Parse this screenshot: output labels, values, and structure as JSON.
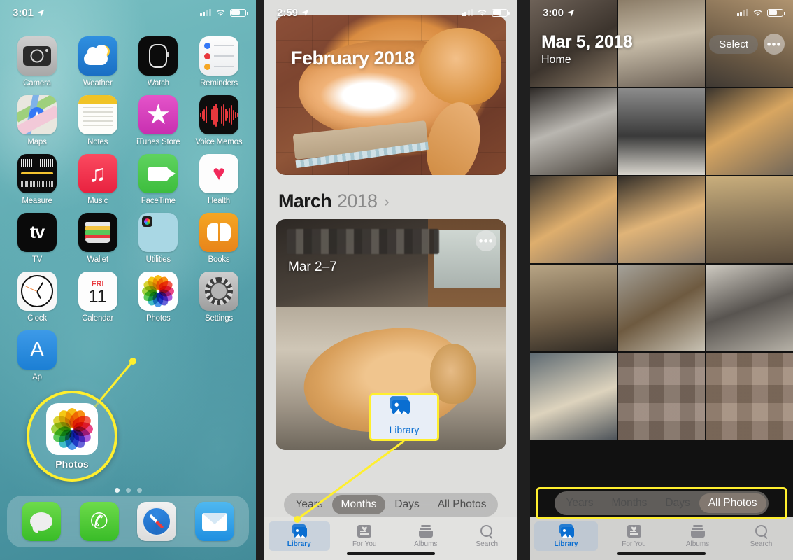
{
  "panel1": {
    "status": {
      "time": "3:01",
      "location_icon": "location-arrow-icon",
      "signal_icon": "cellular-signal-icon",
      "wifi_icon": "wifi-icon",
      "battery_icon": "battery-icon"
    },
    "apps_rows": [
      [
        {
          "label": "Camera",
          "icon": "camera-icon"
        },
        {
          "label": "Weather",
          "icon": "weather-icon"
        },
        {
          "label": "Watch",
          "icon": "watch-icon"
        },
        {
          "label": "Reminders",
          "icon": "reminders-icon"
        }
      ],
      [
        {
          "label": "Maps",
          "icon": "maps-icon"
        },
        {
          "label": "Notes",
          "icon": "notes-icon"
        },
        {
          "label": "iTunes Store",
          "icon": "itunes-store-icon"
        },
        {
          "label": "Voice Memos",
          "icon": "voice-memos-icon"
        }
      ],
      [
        {
          "label": "Measure",
          "icon": "measure-icon"
        },
        {
          "label": "Music",
          "icon": "music-icon"
        },
        {
          "label": "FaceTime",
          "icon": "facetime-icon"
        },
        {
          "label": "Health",
          "icon": "health-icon"
        }
      ],
      [
        {
          "label": "TV",
          "icon": "tv-icon"
        },
        {
          "label": "Wallet",
          "icon": "wallet-icon"
        },
        {
          "label": "Utilities",
          "icon": "utilities-folder-icon"
        },
        {
          "label": "Books",
          "icon": "books-icon"
        }
      ],
      [
        {
          "label": "Clock",
          "icon": "clock-icon"
        },
        {
          "label": "Calendar",
          "icon": "calendar-icon"
        },
        {
          "label": "Photos",
          "icon": "photos-icon"
        },
        {
          "label": "Settings",
          "icon": "settings-icon"
        }
      ],
      [
        {
          "label": "Ap",
          "icon": "app-store-icon"
        }
      ]
    ],
    "calendar": {
      "weekday": "FRI",
      "day": "11"
    },
    "callout": {
      "label": "Photos",
      "icon": "photos-icon",
      "highlight_color": "#ffef2e"
    },
    "dock": [
      {
        "label": "Messages",
        "icon": "messages-icon"
      },
      {
        "label": "Phone",
        "icon": "phone-icon"
      },
      {
        "label": "Safari",
        "icon": "safari-icon"
      },
      {
        "label": "Mail",
        "icon": "mail-icon"
      }
    ],
    "page_dots": 3
  },
  "panel2": {
    "status": {
      "time": "2:59",
      "location_icon": "location-arrow-icon"
    },
    "hero": {
      "title": "February 2018"
    },
    "section": {
      "month": "March",
      "year": "2018",
      "chevron": "›"
    },
    "card": {
      "date_range": "Mar 2–7",
      "more_icon": "more-ellipsis-icon",
      "blurred_location": ""
    },
    "segmented": {
      "options": [
        "Years",
        "Months",
        "Days",
        "All Photos"
      ],
      "selected": "Months"
    },
    "tabs": [
      {
        "label": "Library",
        "icon": "photo-library-icon",
        "active": true
      },
      {
        "label": "For You",
        "icon": "for-you-icon",
        "active": false
      },
      {
        "label": "Albums",
        "icon": "albums-icon",
        "active": false
      },
      {
        "label": "Search",
        "icon": "search-icon",
        "active": false
      }
    ],
    "callout": {
      "label": "Library",
      "icon": "photo-library-icon",
      "highlight_color": "#ffef2e"
    }
  },
  "panel3": {
    "status": {
      "time": "3:00",
      "location_icon": "location-arrow-icon"
    },
    "header": {
      "title": "Mar 5, 2018",
      "subtitle": "Home"
    },
    "actions": {
      "select_label": "Select",
      "more_icon": "more-ellipsis-icon"
    },
    "segmented": {
      "options": [
        "Years",
        "Months",
        "Days",
        "All Photos"
      ],
      "selected": "All Photos",
      "highlight_color": "#ffef2e"
    },
    "tabs": [
      {
        "label": "Library",
        "icon": "photo-library-icon",
        "active": true
      },
      {
        "label": "For You",
        "icon": "for-you-icon",
        "active": false
      },
      {
        "label": "Albums",
        "icon": "albums-icon",
        "active": false
      },
      {
        "label": "Search",
        "icon": "search-icon",
        "active": false
      }
    ],
    "grid_thumbnails": [
      "people-photo",
      "dog-on-couch-photo",
      "cat-in-room-photo",
      "grey-cat-sleeping-photo",
      "dark-shelf-photo",
      "orange-cat-on-bed-photo",
      "orange-cat-lying-photo",
      "orange-cat-stretching-photo",
      "living-room-photo",
      "room-with-tv-photo",
      "cat-at-window-photo",
      "tuxedo-cat-photo",
      "dog-on-sofa-photo",
      "pixelated-photo-1",
      "pixelated-photo-2"
    ]
  }
}
